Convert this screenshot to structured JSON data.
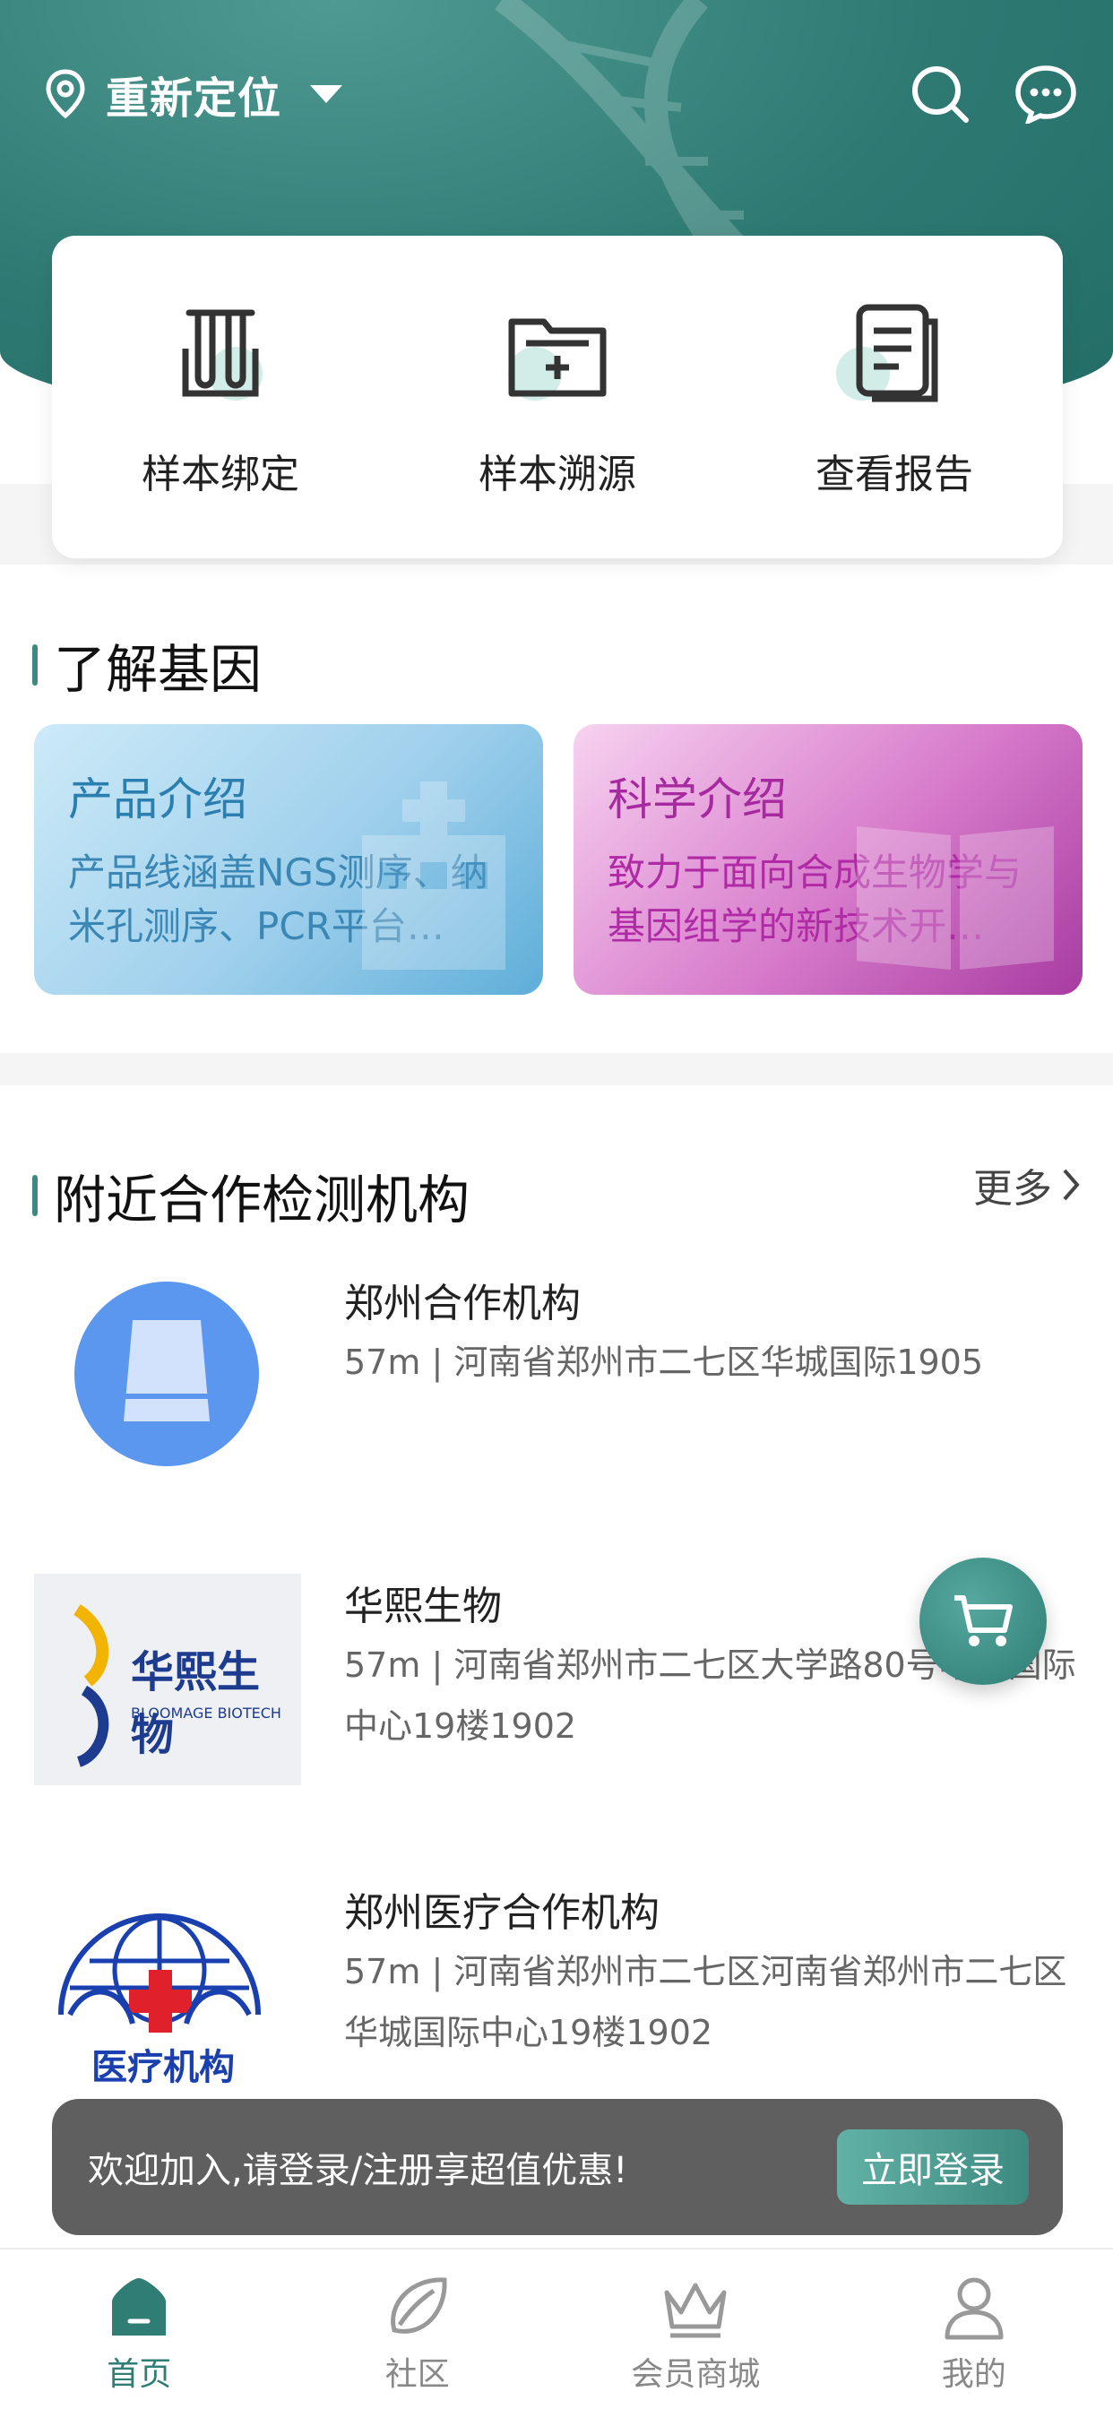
{
  "header": {
    "location_label": "重新定位",
    "icons": [
      "location-pin-icon",
      "search-icon",
      "message-icon"
    ]
  },
  "quick_actions": [
    {
      "label": "样本绑定",
      "icon": "test-tubes-icon"
    },
    {
      "label": "样本溯源",
      "icon": "folder-add-icon"
    },
    {
      "label": "查看报告",
      "icon": "report-icon"
    }
  ],
  "learn_section": {
    "title": "了解基因",
    "cards": [
      {
        "title": "产品介绍",
        "desc": "产品线涵盖NGS测序、纳米孔测序、PCR平台…",
        "color": "#2b7fb0"
      },
      {
        "title": "科学介绍",
        "desc": "致力于面向合成生物学与基因组学的新技术开…",
        "color": "#a6299f"
      }
    ]
  },
  "nearby_section": {
    "title": "附近合作检测机构",
    "more_label": "更多",
    "institutions": [
      {
        "name": "郑州合作机构",
        "address": "57m | 河南省郑州市二七区华城国际1905",
        "logo": "seat-logo"
      },
      {
        "name": "华熙生物",
        "address": "57m | 河南省郑州市二七区大学路80号华城国际中心19楼1902",
        "logo": "bloomage-logo",
        "logo_text_cn": "华熙生物",
        "logo_text_en": "BLOOMAGE BIOTECH"
      },
      {
        "name": "郑州医疗合作机构",
        "address": "57m | 河南省郑州市二七区河南省郑州市二七区华城国际中心19楼1902",
        "logo": "medical-logo",
        "logo_text": "医疗机构"
      }
    ]
  },
  "login_prompt": {
    "text": "欢迎加入,请登录/注册享超值优惠!",
    "button_label": "立即登录"
  },
  "tabbar": [
    {
      "label": "首页",
      "icon": "home-icon",
      "active": true
    },
    {
      "label": "社区",
      "icon": "leaf-icon",
      "active": false
    },
    {
      "label": "会员商城",
      "icon": "crown-icon",
      "active": false
    },
    {
      "label": "我的",
      "icon": "user-icon",
      "active": false
    }
  ],
  "colors": {
    "accent": "#2f7d75",
    "login_bar": "#5f5f5f"
  }
}
